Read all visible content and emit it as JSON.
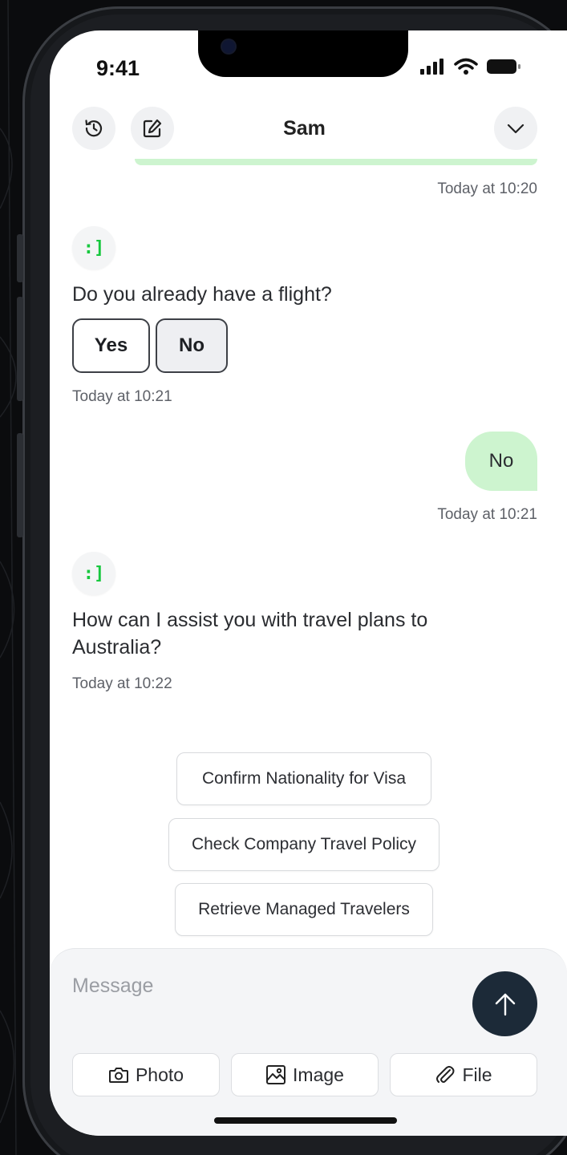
{
  "status_bar": {
    "time": "9:41"
  },
  "header": {
    "title": "Sam"
  },
  "icons": {
    "history": "history-icon",
    "edit": "edit-icon",
    "collapse": "chevron-down-icon",
    "send": "arrow-up-icon",
    "photo": "camera-icon",
    "image": "image-icon",
    "file": "paperclip-icon"
  },
  "colors": {
    "accent_green": "#17c83e",
    "user_bubble": "#cdf4cf",
    "send_button": "#1c2a38"
  },
  "messages": {
    "ts_top": "Today at 10:20",
    "bot1_avatar": ":]",
    "bot1_text": "Do you already have a flight?",
    "bot1_options": [
      "Yes",
      "No"
    ],
    "bot1_ts": "Today at 10:21",
    "user1_text": "No",
    "user1_ts": "Today at 10:21",
    "bot2_avatar": ":]",
    "bot2_text": "How can I assist you with travel plans to Australia?",
    "bot2_ts": "Today at 10:22"
  },
  "suggestions": [
    "Confirm Nationality for Visa",
    "Check Company Travel Policy",
    "Retrieve Managed Travelers"
  ],
  "composer": {
    "placeholder": "Message",
    "photo_label": "Photo",
    "image_label": "Image",
    "file_label": "File"
  }
}
